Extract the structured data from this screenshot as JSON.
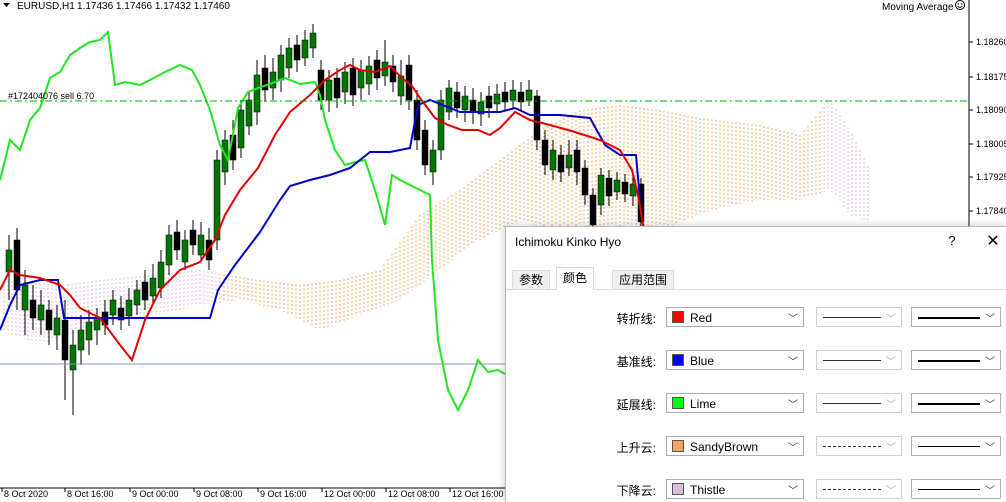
{
  "chart": {
    "symbol_label": "EURUSD,H1",
    "ohlc_label": "1.17436 1.17466 1.17432 1.17460",
    "indicator_name": "Moving Average",
    "order_label": "#172404076 sell 6.70",
    "price_labels": [
      "1.18260",
      "1.18175",
      "1.18090",
      "1.18005",
      "1.17925",
      "1.17840"
    ],
    "time_labels": [
      "8 Oct 2020",
      "8 Oct 16:00",
      "9 Oct 00:00",
      "9 Oct 08:00",
      "9 Oct 16:00",
      "12 Oct 00:00",
      "12 Oct 08:00",
      "12 Oct 16:00"
    ],
    "colors": {
      "tenkan": "#e00000",
      "kijun": "#0000c8",
      "chikou": "#22e622",
      "kumo_up": "#f4a460",
      "kumo_down": "#d8bfd8",
      "order_line": "#00b000",
      "candle": "#007700"
    }
  },
  "dialog": {
    "title": "Ichimoku Kinko Hyo",
    "help_label": "?",
    "close_label": "✕",
    "tabs": [
      {
        "label": "参数",
        "active": false
      },
      {
        "label": "颜色",
        "active": true
      },
      {
        "label": "应用范围",
        "active": false
      }
    ],
    "rows": [
      {
        "label": "转折线:",
        "color_name": "Red",
        "swatch": "#ff0000",
        "style": "solid",
        "width": "thick"
      },
      {
        "label": "基准线:",
        "color_name": "Blue",
        "swatch": "#0000ff",
        "style": "solid",
        "width": "thick"
      },
      {
        "label": "延展线:",
        "color_name": "Lime",
        "swatch": "#00ff00",
        "style": "solid",
        "width": "thick"
      },
      {
        "label": "上升云:",
        "color_name": "SandyBrown",
        "swatch": "#f4a460",
        "style": "dashed",
        "width": "thin"
      },
      {
        "label": "下降云:",
        "color_name": "Thistle",
        "swatch": "#d8bfd8",
        "style": "dashed",
        "width": "thin"
      }
    ]
  }
}
